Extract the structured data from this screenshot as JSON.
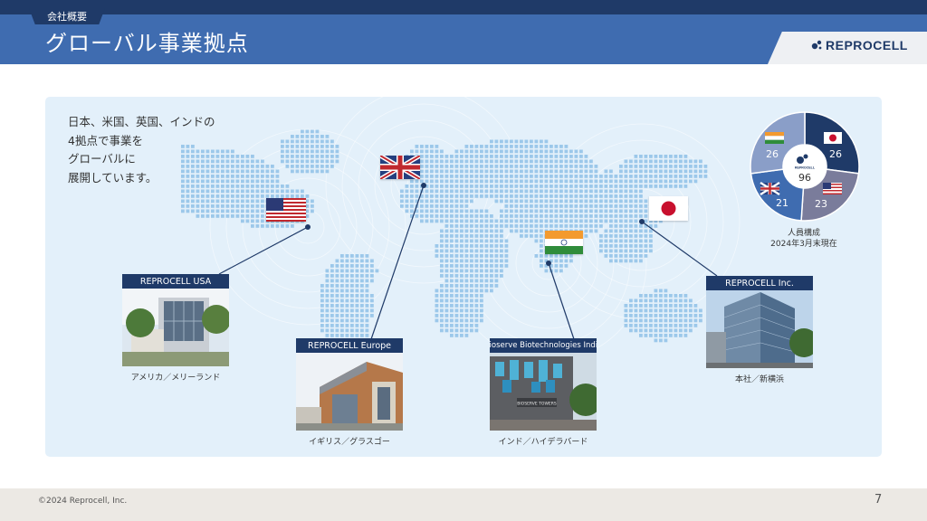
{
  "header": {
    "section_tab": "会社概要",
    "title": "グローバル事業拠点",
    "logo_text": "REPROCELL"
  },
  "intro_lines": [
    "日本、米国、英国、インドの",
    "4拠点で事業を",
    "グローバルに",
    "展開しています。"
  ],
  "locations": [
    {
      "label": "REPROCELL USA",
      "caption": "アメリカ／メリーランド"
    },
    {
      "label": "REPROCELL Europe",
      "caption": "イギリス／グラスゴー"
    },
    {
      "label": "Bioserve Biotechnologies India",
      "caption": "インド／ハイデラバード"
    },
    {
      "label": "REPROCELL Inc.",
      "caption": "本社／新横浜"
    }
  ],
  "photo_signs": {
    "india": "BIOSERVE TOWERS"
  },
  "staff": {
    "total": "96",
    "center_logo": "REPROCELL",
    "segments": [
      {
        "country": "Japan",
        "value": "26",
        "count": 26,
        "color": "#1f3a68"
      },
      {
        "country": "USA",
        "value": "23",
        "count": 23,
        "color": "#7a7c9b"
      },
      {
        "country": "UK",
        "value": "21",
        "count": 21,
        "color": "#3f6cb0"
      },
      {
        "country": "India",
        "value": "26",
        "count": 26,
        "color": "#8a9ec8"
      }
    ],
    "caption_line1": "人員構成",
    "caption_line2": "2024年3月末現在"
  },
  "colors": {
    "navy": "#1f3a68",
    "blue": "#3f6cb0",
    "panel": "#e3f0fa",
    "map_dot": "#9cc8ea"
  },
  "footer": {
    "copyright": "©2024 Reprocell, Inc.",
    "page_number": "7"
  }
}
